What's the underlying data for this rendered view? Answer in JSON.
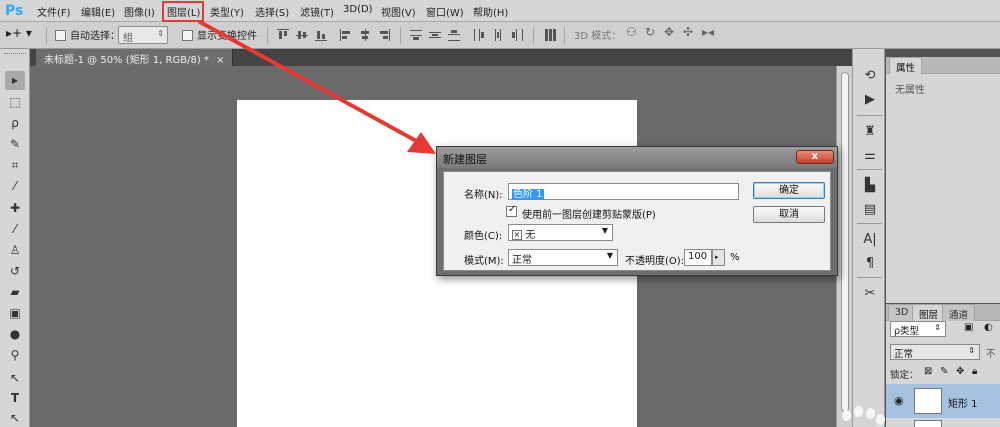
{
  "app": {
    "logo": "Ps"
  },
  "menu": {
    "items": [
      "文件(F)",
      "编辑(E)",
      "图像(I)",
      "图层(L)",
      "类型(Y)",
      "选择(S)",
      "滤镜(T)",
      "3D(D)",
      "视图(V)",
      "窗口(W)",
      "帮助(H)"
    ],
    "highlighted": "图层(L)"
  },
  "options": {
    "auto_select_label": "自动选择：",
    "auto_select_value": "组",
    "show_transform_label": "显示变换控件",
    "mode_3d_label": "3D 模式："
  },
  "document": {
    "tab_title": "未标题-1 @ 50% (矩形 1, RGB/8) *",
    "tab_close": "×"
  },
  "right_panels": {
    "properties_tab": "属性",
    "no_properties": "无属性",
    "layers_tabs": [
      "3D",
      "图层",
      "通道"
    ],
    "filter_value": "ρ类型",
    "blend_mode": "正常",
    "opacity_label": "不",
    "lock_label": "锁定：",
    "layer_name": "矩形 1"
  },
  "dialog": {
    "title": "新建图层",
    "close_label": "x",
    "name_label": "名称(N):",
    "name_value": "色阶 1",
    "clip_checkbox_label": "使用前一图层创建剪贴蒙版(P)",
    "color_label": "颜色(C):",
    "color_value": "无",
    "color_swatch": "×",
    "mode_label": "模式(M):",
    "mode_value": "正常",
    "opacity_label": "不透明度(O):",
    "opacity_value": "100",
    "opacity_unit": "%",
    "ok_label": "确定",
    "cancel_label": "取消"
  },
  "colors": {
    "highlight_red": "#e53935",
    "selection_blue": "#3399ff",
    "layer_selected": "#a7c2e1",
    "ps_blue": "#31a8ff"
  }
}
